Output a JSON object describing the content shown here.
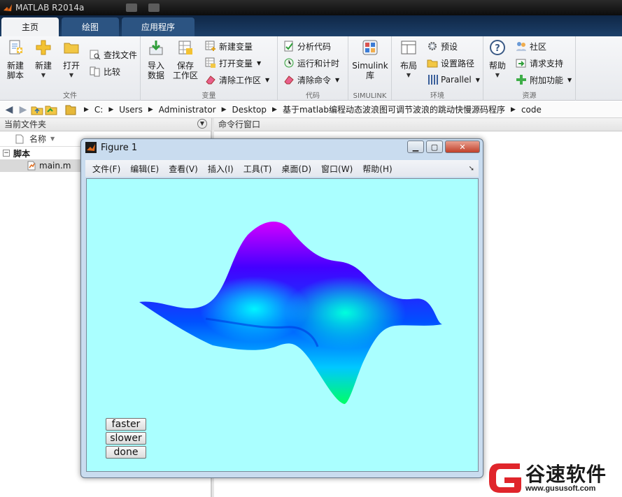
{
  "app": {
    "title": "MATLAB R2014a"
  },
  "tabs": [
    {
      "label": "主页",
      "active": true
    },
    {
      "label": "绘图",
      "active": false
    },
    {
      "label": "应用程序",
      "active": false
    }
  ],
  "ribbon": {
    "file": {
      "label": "文件",
      "new_script": "新建\n脚本",
      "new": "新建",
      "open": "打开",
      "find_files": "查找文件",
      "compare": "比较"
    },
    "variable": {
      "label": "变量",
      "import": "导入\n数据",
      "save": "保存\n工作区",
      "new_var": "新建变量",
      "open_var": "打开变量",
      "clear_ws": "清除工作区"
    },
    "code": {
      "label": "代码",
      "analyze": "分析代码",
      "run_time": "运行和计时",
      "clear_cmd": "清除命令"
    },
    "simulink": {
      "label": "SIMULINK",
      "lib": "Simulink\n库"
    },
    "env": {
      "label": "环境",
      "layout": "布局",
      "prefs": "预设",
      "set_path": "设置路径",
      "parallel": "Parallel"
    },
    "resources": {
      "label": "资源",
      "help": "帮助",
      "community": "社区",
      "support": "请求支持",
      "addons": "附加功能"
    }
  },
  "address": {
    "segments": [
      "C:",
      "Users",
      "Administrator",
      "Desktop",
      "基于matlab编程动态波浪图可调节波浪的跳动快慢源码程序",
      "code"
    ]
  },
  "current_folder": {
    "title": "当前文件夹",
    "col_name": "名称",
    "group": "脚本",
    "file": "main.m"
  },
  "command_window": {
    "title": "命令行窗口"
  },
  "figure": {
    "title": "Figure 1",
    "menu": [
      "文件(F)",
      "编辑(E)",
      "查看(V)",
      "插入(I)",
      "工具(T)",
      "桌面(D)",
      "窗口(W)",
      "帮助(H)"
    ],
    "canvas_bg": "#aaffff",
    "buttons": {
      "faster": "faster",
      "slower": "slower",
      "done": "done"
    }
  },
  "watermark": {
    "brand": "谷速软件",
    "url": "www.gususoft.com",
    "color": "#e0252b"
  },
  "colors": {
    "tab_active_bg": "#f2f3f5",
    "tabstrip": "#1c3f69",
    "surface_top": "#ff00ff",
    "surface_mid": "#0000ff",
    "surface_low": "#00ff80"
  }
}
